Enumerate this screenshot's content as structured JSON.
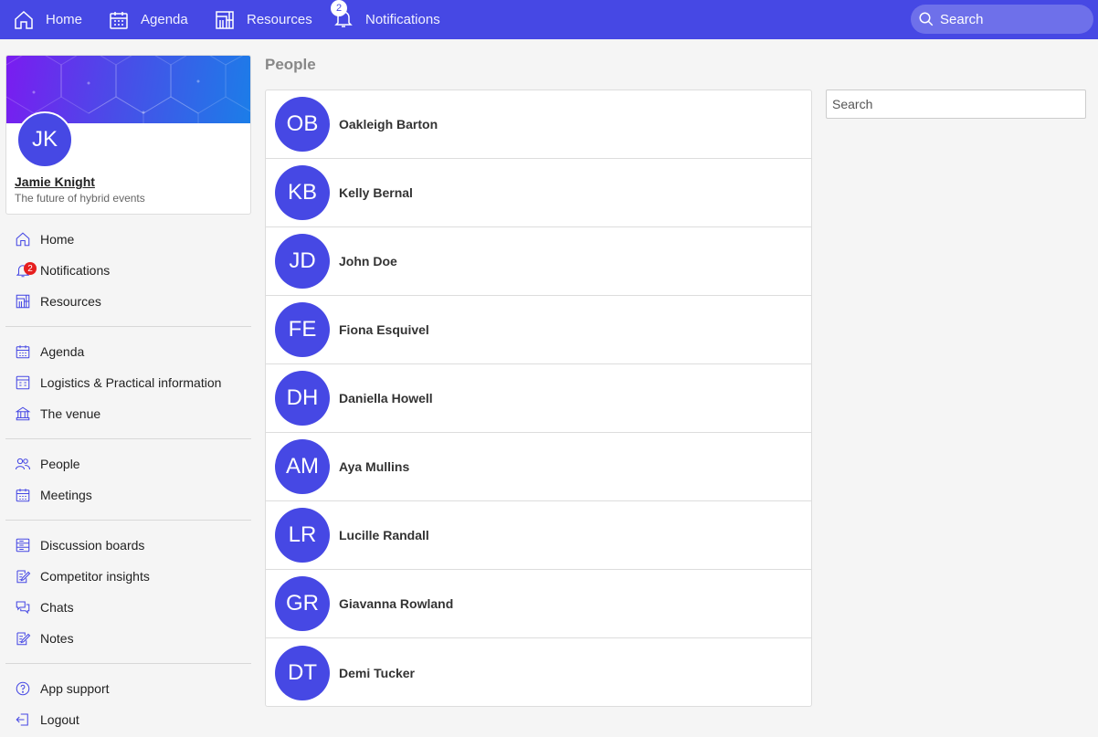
{
  "topbar": {
    "items": [
      {
        "label": "Home",
        "icon": "home-icon"
      },
      {
        "label": "Agenda",
        "icon": "calendar-icon"
      },
      {
        "label": "Resources",
        "icon": "resources-icon"
      },
      {
        "label": "Notifications",
        "icon": "bell-icon",
        "badge": "2"
      }
    ],
    "search_label": "Search"
  },
  "profile": {
    "initials": "JK",
    "name": "Jamie Knight",
    "tagline": "The future of hybrid events"
  },
  "sidebar": {
    "groups": [
      [
        {
          "label": "Home",
          "icon": "home-icon"
        },
        {
          "label": "Notifications",
          "icon": "bell-icon",
          "badge": "2"
        },
        {
          "label": "Resources",
          "icon": "resources-icon"
        }
      ],
      [
        {
          "label": "Agenda",
          "icon": "calendar-icon"
        },
        {
          "label": "Logistics & Practical information",
          "icon": "logistics-icon"
        },
        {
          "label": "The venue",
          "icon": "venue-icon"
        }
      ],
      [
        {
          "label": "People",
          "icon": "people-icon"
        },
        {
          "label": "Meetings",
          "icon": "calendar-icon"
        }
      ],
      [
        {
          "label": "Discussion boards",
          "icon": "board-icon"
        },
        {
          "label": "Competitor insights",
          "icon": "edit-note-icon"
        },
        {
          "label": "Chats",
          "icon": "chat-icon"
        },
        {
          "label": "Notes",
          "icon": "edit-note-icon"
        }
      ],
      [
        {
          "label": "App support",
          "icon": "help-icon"
        },
        {
          "label": "Logout",
          "icon": "logout-icon"
        }
      ]
    ]
  },
  "main": {
    "title": "People",
    "search_placeholder": "Search",
    "people": [
      {
        "initials": "OB",
        "name": "Oakleigh Barton"
      },
      {
        "initials": "KB",
        "name": "Kelly Bernal"
      },
      {
        "initials": "JD",
        "name": "John Doe"
      },
      {
        "initials": "FE",
        "name": "Fiona Esquivel"
      },
      {
        "initials": "DH",
        "name": "Daniella Howell"
      },
      {
        "initials": "AM",
        "name": "Aya Mullins"
      },
      {
        "initials": "LR",
        "name": "Lucille Randall"
      },
      {
        "initials": "GR",
        "name": "Giavanna Rowland"
      },
      {
        "initials": "DT",
        "name": "Demi Tucker"
      }
    ]
  },
  "colors": {
    "accent": "#4648e4",
    "badge_red": "#e61e1e"
  }
}
